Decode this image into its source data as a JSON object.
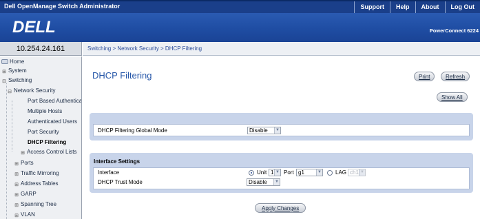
{
  "header": {
    "app_title": "Dell OpenManage Switch Administrator",
    "links": [
      "Support",
      "Help",
      "About",
      "Log Out"
    ],
    "logo": "DELL",
    "product": "PowerConnect 6224"
  },
  "address": {
    "ip": "10.254.24.161",
    "breadcrumb": "Switching > Network Security > DHCP Filtering"
  },
  "tree": {
    "home": "Home",
    "system": "System",
    "switching": "Switching",
    "network_security": "Network Security",
    "port_based_auth": "Port Based Authentication",
    "multiple_hosts": "Multiple Hosts",
    "authenticated_users": "Authenticated Users",
    "port_security": "Port Security",
    "dhcp_filtering": "DHCP Filtering",
    "access_control_lists": "Access Control Lists",
    "ports": "Ports",
    "traffic_mirroring": "Traffic Mirroring",
    "address_tables": "Address Tables",
    "garp": "GARP",
    "spanning_tree": "Spanning Tree",
    "vlan": "VLAN"
  },
  "main": {
    "title": "DHCP Filtering",
    "print": "Print",
    "refresh": "Refresh",
    "show_all": "Show All",
    "global_mode_label": "DHCP Filtering Global Mode",
    "global_mode_value": "Disable",
    "interface_settings": "Interface Settings",
    "interface_label": "Interface",
    "unit_label": "Unit",
    "unit_value": "1",
    "port_label": "Port",
    "port_value": "g1",
    "lag_label": "LAG",
    "lag_value": "ch1",
    "trust_mode_label": "DHCP Trust Mode",
    "trust_mode_value": "Disable",
    "apply": "Apply Changes"
  },
  "colors": {
    "header_blue": "#1a3f8a",
    "title_blue": "#2556a8",
    "panel_blue": "#c8d4ea"
  }
}
